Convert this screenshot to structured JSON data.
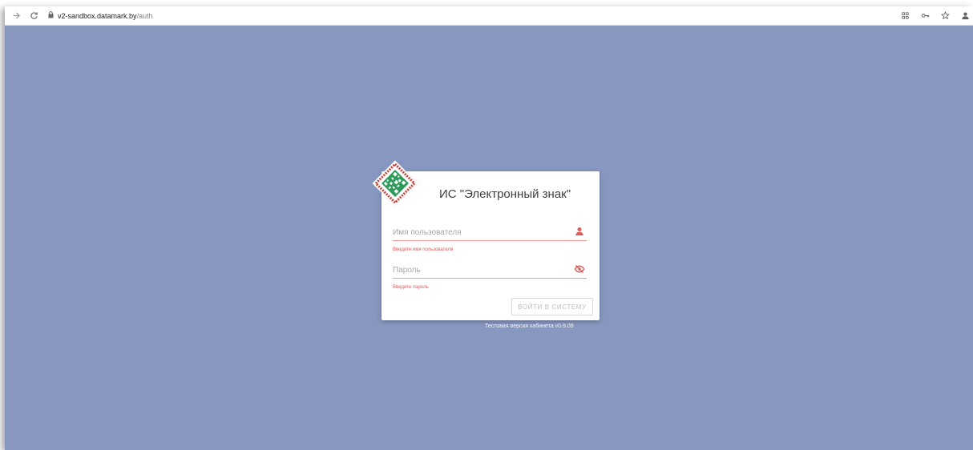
{
  "browser": {
    "url_host": "v2-sandbox.datamark.by",
    "url_path": "/auth",
    "icons": [
      "back-icon",
      "reload-icon",
      "lock-icon",
      "extension-icon",
      "key-icon",
      "star-icon",
      "profile-icon"
    ]
  },
  "login": {
    "title": "ИС \"Электронный знак\"",
    "username": {
      "placeholder": "Имя пользователя",
      "value": "",
      "error": "Введите имя пользователя",
      "icon": "user-icon"
    },
    "password": {
      "placeholder": "Пароль",
      "value": "",
      "error": "Введите пароль",
      "icon": "eye-off-icon"
    },
    "submit_label": "ВОЙТИ В СИСТЕМУ",
    "footer": "Тестовая версия кабинета v0.9.09"
  },
  "colors": {
    "background": "#8797bf",
    "accent": "#e05a5a",
    "logo_red": "#c9443c",
    "logo_green": "#2e9a5c"
  }
}
